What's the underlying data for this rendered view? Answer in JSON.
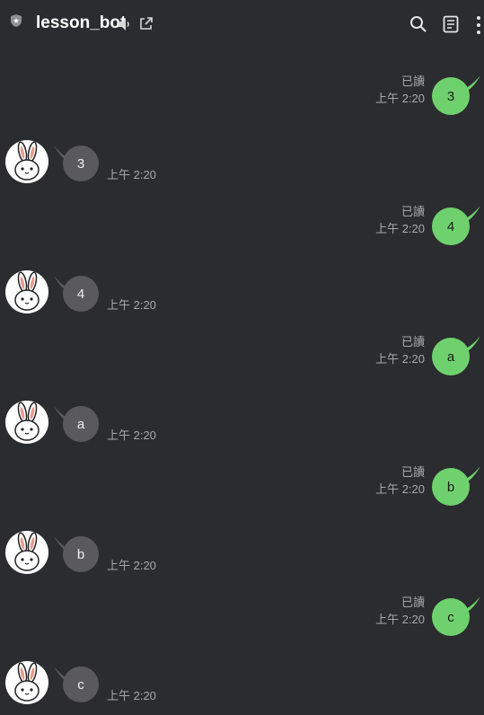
{
  "header": {
    "title": "lesson_bot",
    "icons": [
      "shield-icon",
      "speaker-icon",
      "external-link-icon",
      "search-icon",
      "memo-icon",
      "more-icon"
    ]
  },
  "messages": [
    {
      "from": "me",
      "text": "3",
      "read": "已讀",
      "time": "上午 2:20"
    },
    {
      "from": "bot",
      "text": "3",
      "time": "上午 2:20"
    },
    {
      "from": "me",
      "text": "4",
      "read": "已讀",
      "time": "上午 2:20"
    },
    {
      "from": "bot",
      "text": "4",
      "time": "上午 2:20"
    },
    {
      "from": "me",
      "text": "a",
      "read": "已讀",
      "time": "上午 2:20"
    },
    {
      "from": "bot",
      "text": "a",
      "time": "上午 2:20"
    },
    {
      "from": "me",
      "text": "b",
      "read": "已讀",
      "time": "上午 2:20"
    },
    {
      "from": "bot",
      "text": "b",
      "time": "上午 2:20"
    },
    {
      "from": "me",
      "text": "c",
      "read": "已讀",
      "time": "上午 2:20"
    },
    {
      "from": "bot",
      "text": "c",
      "time": "上午 2:20"
    }
  ],
  "colors": {
    "background": "#2b2c2f",
    "outgoing_bubble": "#6fd16e",
    "incoming_bubble": "#5a5a5c",
    "meta_text": "#a8a9ab"
  }
}
